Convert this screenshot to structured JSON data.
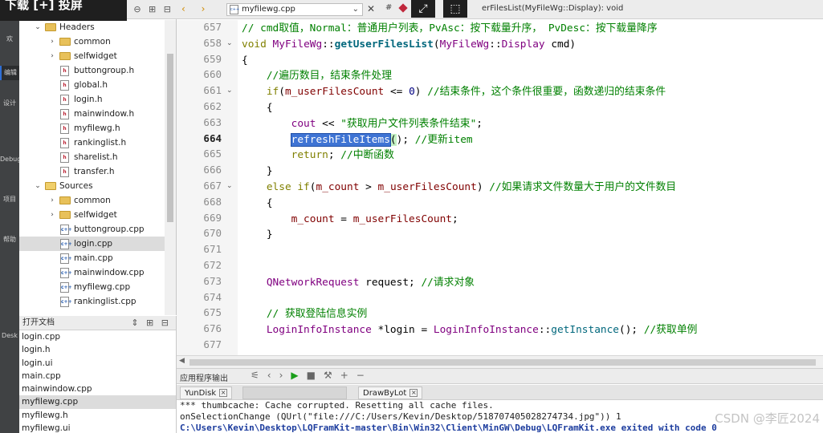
{
  "overlay": {
    "text": "下载 [+] 投屏"
  },
  "tree": {
    "rows": [
      {
        "label": "Headers",
        "kind": "folder-root",
        "indent": 1,
        "arrow": "⌄"
      },
      {
        "label": "common",
        "kind": "folder",
        "indent": 2,
        "arrow": "›"
      },
      {
        "label": "selfwidget",
        "kind": "folder",
        "indent": 2,
        "arrow": "›"
      },
      {
        "label": "buttongroup.h",
        "kind": "h",
        "indent": 2
      },
      {
        "label": "global.h",
        "kind": "h",
        "indent": 2
      },
      {
        "label": "login.h",
        "kind": "h",
        "indent": 2
      },
      {
        "label": "mainwindow.h",
        "kind": "h",
        "indent": 2
      },
      {
        "label": "myfilewg.h",
        "kind": "h",
        "indent": 2
      },
      {
        "label": "rankinglist.h",
        "kind": "h",
        "indent": 2
      },
      {
        "label": "sharelist.h",
        "kind": "h",
        "indent": 2
      },
      {
        "label": "transfer.h",
        "kind": "h",
        "indent": 2
      },
      {
        "label": "Sources",
        "kind": "folder-root-src",
        "indent": 1,
        "arrow": "⌄"
      },
      {
        "label": "common",
        "kind": "folder",
        "indent": 2,
        "arrow": "›"
      },
      {
        "label": "selfwidget",
        "kind": "folder",
        "indent": 2,
        "arrow": "›"
      },
      {
        "label": "buttongroup.cpp",
        "kind": "cpp",
        "indent": 2
      },
      {
        "label": "login.cpp",
        "kind": "cpp",
        "indent": 2,
        "selected": true
      },
      {
        "label": "main.cpp",
        "kind": "cpp",
        "indent": 2
      },
      {
        "label": "mainwindow.cpp",
        "kind": "cpp",
        "indent": 2
      },
      {
        "label": "myfilewg.cpp",
        "kind": "cpp",
        "indent": 2
      },
      {
        "label": "rankinglist.cpp",
        "kind": "cpp",
        "indent": 2
      }
    ]
  },
  "open_docs": {
    "title": "打开文档",
    "items": [
      "login.cpp",
      "login.h",
      "login.ui",
      "main.cpp",
      "mainwindow.cpp",
      "myfilewg.cpp",
      "myfilewg.h",
      "myfilewg.ui"
    ],
    "selected_index": 5
  },
  "editor": {
    "file_name": "myfilewg.cpp",
    "function_name": "erFilesList(MyFileWg::Display): void",
    "current_line": "664"
  },
  "code_lines": [
    {
      "n": "657",
      "html": "<span class='cm'>// cmd取值，Normal：普通用户列表，PvAsc：按下载量升序， PvDesc：按下载量降序</span>"
    },
    {
      "n": "658",
      "fold": true,
      "html": "<span class='kw'>void</span> <span class='ty'>MyFileWg</span>::<span class='fnb'>getUserFilesList</span>(<span class='ty'>MyFileWg</span>::<span class='ty'>Display</span> cmd)"
    },
    {
      "n": "659",
      "html": "{"
    },
    {
      "n": "660",
      "html": "    <span class='cm'>//遍历数目，结束条件处理</span>"
    },
    {
      "n": "661",
      "fold": true,
      "html": "    <span class='kw'>if</span>(<span class='mv'>m_userFilesCount</span> &lt;= <span class='nm'>0</span>) <span class='cm'>//结束条件，这个条件很重要，函数递归的结束条件</span>"
    },
    {
      "n": "662",
      "html": "    {"
    },
    {
      "n": "663",
      "html": "        <span class='ty'>cout</span> &lt;&lt; <span class='st'>\"获取用户文件列表条件结束\"</span>;"
    },
    {
      "n": "664",
      "html": "        <span class='hl'>refreshFileItems</span><span class='hlp'>(</span>)<span class='hlp'></span>; <span class='cm'>//更新item</span>"
    },
    {
      "n": "665",
      "html": "        <span class='kw'>return</span>; <span class='cm'>//中断函数</span>"
    },
    {
      "n": "666",
      "html": "    }"
    },
    {
      "n": "667",
      "fold": true,
      "html": "    <span class='kw'>else if</span>(<span class='mv'>m_count</span> &gt; <span class='mv'>m_userFilesCount</span>) <span class='cm'>//如果请求文件数量大于用户的文件数目</span>"
    },
    {
      "n": "668",
      "html": "    {"
    },
    {
      "n": "669",
      "html": "        <span class='mv'>m_count</span> = <span class='mv'>m_userFilesCount</span>;"
    },
    {
      "n": "670",
      "html": "    }"
    },
    {
      "n": "671",
      "html": ""
    },
    {
      "n": "672",
      "html": ""
    },
    {
      "n": "673",
      "html": "    <span class='ty'>QNetworkRequest</span> request; <span class='cm'>//请求对象</span>"
    },
    {
      "n": "674",
      "html": ""
    },
    {
      "n": "675",
      "html": "    <span class='cm'>// 获取登陆信息实例</span>"
    },
    {
      "n": "676",
      "html": "    <span class='ty'>LoginInfoInstance</span> *login = <span class='ty'>LoginInfoInstance</span>::<span class='fn'>getInstance</span>(); <span class='cm'>//获取单例</span>"
    },
    {
      "n": "677",
      "html": ""
    }
  ],
  "output": {
    "title": "应用程序输出",
    "tabs": [
      {
        "label": "YunDisk"
      },
      {
        "label": "",
        "blurred": true
      },
      {
        "label": "DrawByLot"
      }
    ],
    "lines": [
      "*** thumbcache: Cache corrupted. Resetting all cache files.",
      "onSelectionChange (QUrl(\"file:///C:/Users/Kevin/Desktop/518707405028274734.jpg\")) 1",
      "C:\\Users\\Kevin\\Desktop\\LQFramKit-master\\Bin\\Win32\\Client\\MinGW\\Debug\\LQFramKit.exe exited with code 0"
    ]
  },
  "watermark": "CSDN @李匠2024",
  "rail_modes": [
    "欢",
    "编辑",
    "设计",
    "Debug",
    "项目",
    "帮助",
    "Desk"
  ]
}
